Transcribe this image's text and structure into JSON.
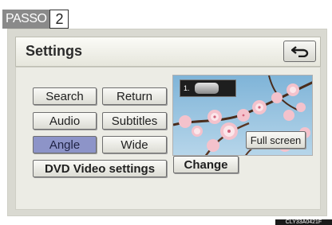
{
  "step": {
    "label": "PASSO",
    "number": "2"
  },
  "screen": {
    "title": "Settings",
    "back_icon": "return-arrow-icon",
    "buttons": {
      "search": "Search",
      "return": "Return",
      "audio": "Audio",
      "subtitles": "Subtitles",
      "angle": "Angle",
      "wide": "Wide",
      "dvd_video_settings": "DVD Video settings",
      "change": "Change"
    },
    "selected_button": "Angle",
    "preview": {
      "tag_number": "1.",
      "tag_icon": "disc-icon",
      "full_screen_label": "Full screen"
    }
  },
  "image_code": "CLY33A0421F",
  "colors": {
    "selected_button": "#8d94c8",
    "screen_bg": "#d9d9d1",
    "panel_bg": "#ecece5"
  }
}
